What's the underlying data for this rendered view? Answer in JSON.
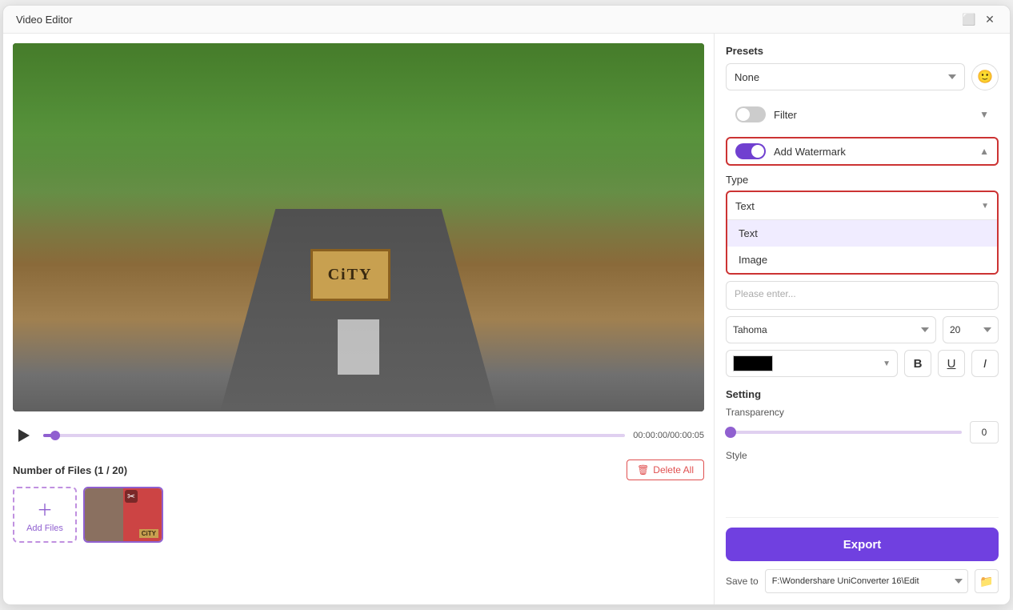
{
  "window": {
    "title": "Video Editor"
  },
  "titlebar": {
    "title": "Video Editor",
    "maximize_label": "⬜",
    "close_label": "✕"
  },
  "presets": {
    "label": "Presets",
    "value": "None",
    "options": [
      "None"
    ]
  },
  "filter": {
    "label": "Filter"
  },
  "watermark": {
    "label": "Add Watermark"
  },
  "type_section": {
    "label": "Type",
    "selected": "Text",
    "options": [
      {
        "label": "Text"
      },
      {
        "label": "Image"
      }
    ]
  },
  "text_input": {
    "placeholder": "Please enter..."
  },
  "font": {
    "family": "Tahoma",
    "size": "20"
  },
  "setting": {
    "label": "Setting",
    "transparency_label": "Transparency",
    "transparency_value": "0",
    "style_label": "Style"
  },
  "export_btn": {
    "label": "Export"
  },
  "save_to": {
    "label": "Save to",
    "path": "F:\\Wondershare UniConverter 16\\Edit"
  },
  "playback": {
    "time": "00:00:00/00:00:05"
  },
  "files": {
    "count_label": "Number of Files (1 / 20)",
    "add_label": "Add Files",
    "delete_all_label": "Delete All"
  },
  "style_buttons": {
    "bold": "B",
    "underline": "U",
    "italic": "I"
  }
}
